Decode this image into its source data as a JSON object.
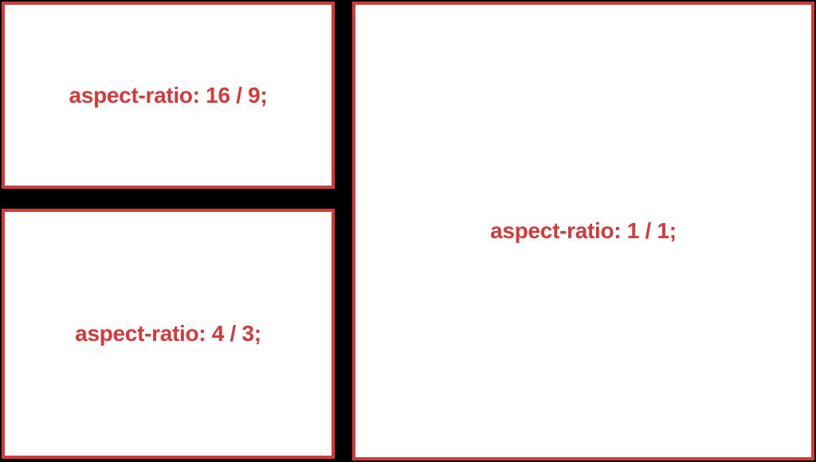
{
  "boxes": {
    "ratio_16_9": {
      "label": "aspect-ratio: 16 / 9;"
    },
    "ratio_4_3": {
      "label": "aspect-ratio: 4 / 3;"
    },
    "ratio_1_1": {
      "label": "aspect-ratio: 1 / 1;"
    }
  },
  "colors": {
    "accent": "#d93838",
    "background": "#000000",
    "box_fill": "#ffffff"
  }
}
